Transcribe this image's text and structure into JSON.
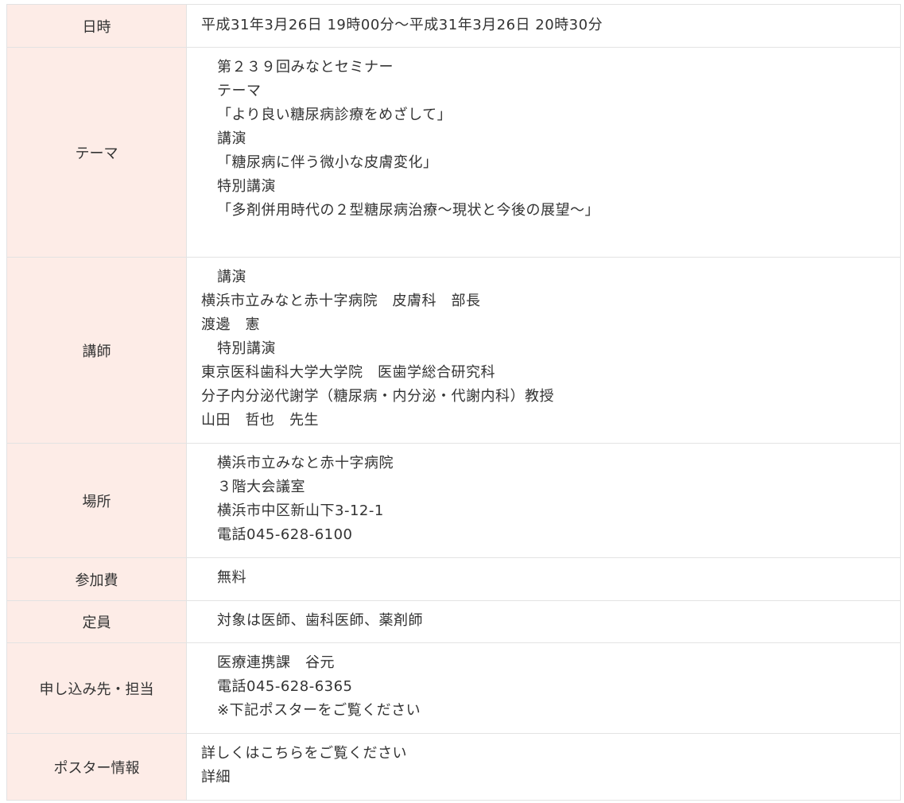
{
  "rows": {
    "datetime": {
      "label": "日時",
      "line1": "平成31年3月26日 19時00分～平成31年3月26日 20時30分"
    },
    "theme": {
      "label": "テーマ",
      "line1": "第２３９回みなとセミナー",
      "line2": "テーマ",
      "line3": "「より良い糖尿病診療をめざして」",
      "line4": "講演",
      "line5": "「糖尿病に伴う微小な皮膚変化」",
      "line6": "特別講演",
      "line7": "「多剤併用時代の２型糖尿病治療～現状と今後の展望～」"
    },
    "speaker": {
      "label": "講師",
      "line1": "講演",
      "line2": "横浜市立みなと赤十字病院　皮膚科　部長",
      "line3": "渡邊　憲",
      "line4": "特別講演",
      "line5": "東京医科歯科大学大学院　医歯学総合研究科",
      "line6": "分子内分泌代謝学（糖尿病・内分泌・代謝内科）教授",
      "line7": "山田　哲也　先生"
    },
    "place": {
      "label": "場所",
      "line1": "横浜市立みなと赤十字病院",
      "line2": "３階大会議室",
      "line3": "横浜市中区新山下3-12-1",
      "line4": "電話045-628-6100"
    },
    "fee": {
      "label": "参加費",
      "line1": "無料"
    },
    "capacity": {
      "label": "定員",
      "line1": "対象は医師、歯科医師、薬剤師"
    },
    "apply": {
      "label": "申し込み先・担当",
      "line1": "医療連携課　谷元",
      "line2": "電話045-628-6365",
      "line3": "※下記ポスターをご覧ください"
    },
    "poster": {
      "label": "ポスター情報",
      "line1": "詳しくはこちらをご覧ください",
      "link": "詳細"
    }
  }
}
